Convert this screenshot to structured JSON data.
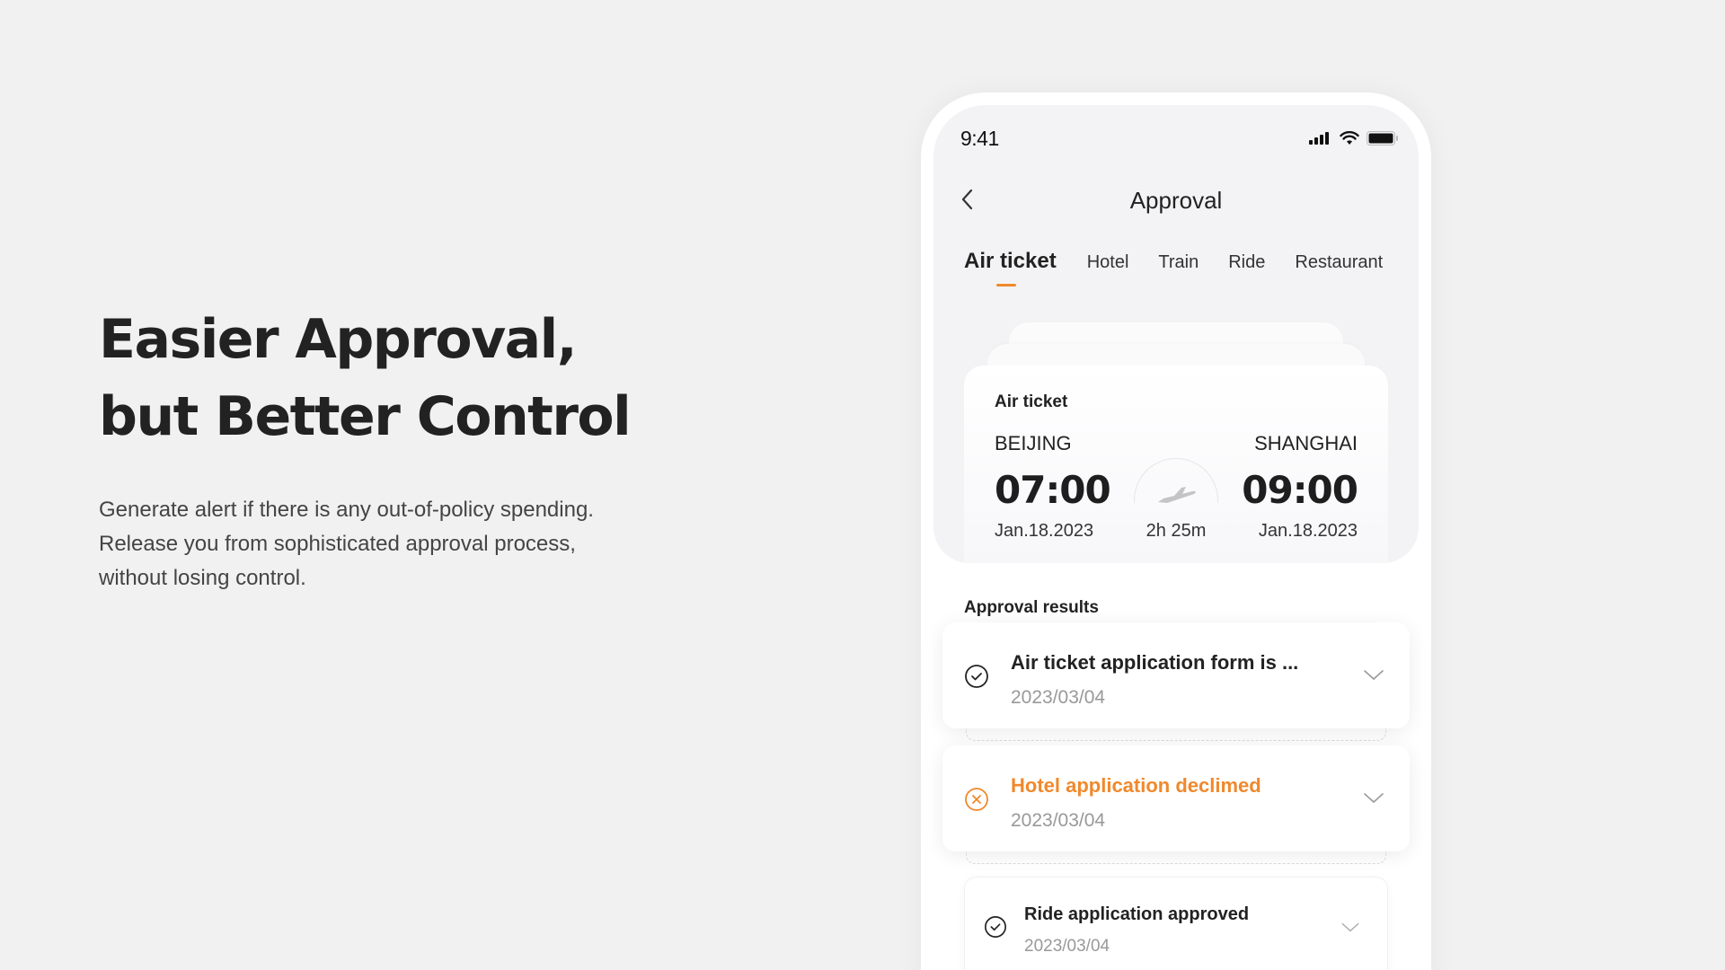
{
  "hero": {
    "title_line1": "Easier Approval,",
    "title_line2": "but Better Control",
    "description_line1": "Generate alert if there is any out-of-policy spending.",
    "description_line2": "Release you from sophisticated approval process,",
    "description_line3": "without losing control."
  },
  "status_bar": {
    "time": "9:41",
    "icons": [
      "signal-icon",
      "wifi-icon",
      "battery-icon"
    ]
  },
  "navbar": {
    "back_icon": "chevron-left-icon",
    "title": "Approval"
  },
  "tabs": [
    {
      "label": "Air ticket",
      "active": true
    },
    {
      "label": "Hotel",
      "active": false
    },
    {
      "label": "Train",
      "active": false
    },
    {
      "label": "Ride",
      "active": false
    },
    {
      "label": "Restaurant",
      "active": false
    }
  ],
  "ticket": {
    "label": "Air ticket",
    "from_city": "BEIJING",
    "to_city": "SHANGHAI",
    "depart_time": "07:00",
    "arrive_time": "09:00",
    "depart_date": "Jan.18.2023",
    "arrive_date": "Jan.18.2023",
    "duration": "2h 25m",
    "icon": "airplane-icon"
  },
  "results": {
    "title": "Approval results",
    "items": [
      {
        "title": "Air ticket application form is ...",
        "date": "2023/03/04",
        "status": "approved",
        "icon": "check-circle-icon"
      },
      {
        "title": "Hotel application declimed",
        "date": "2023/03/04",
        "status": "declined",
        "icon": "x-circle-icon"
      },
      {
        "title": "Ride application approved",
        "date": "2023/03/04",
        "status": "approved",
        "icon": "check-circle-icon"
      }
    ]
  },
  "colors": {
    "accent": "#f0892c",
    "background": "#f1f1f1",
    "text_dark": "#222222",
    "text_muted": "#999999"
  }
}
